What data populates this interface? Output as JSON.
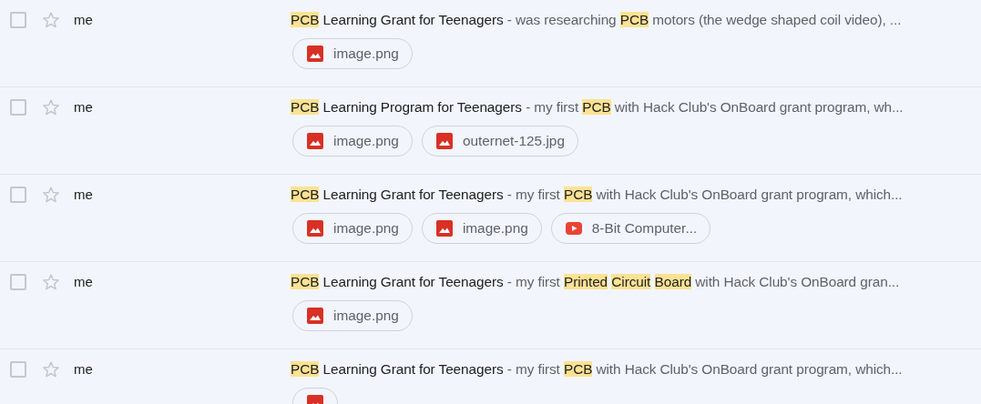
{
  "messages": [
    {
      "checked": false,
      "starred": false,
      "sender": "me",
      "subject": [
        {
          "text": "PCB",
          "highlight": true
        },
        {
          "text": " Learning Grant for Teenagers",
          "highlight": false
        }
      ],
      "snippet": [
        {
          "text": " - was researching ",
          "highlight": false
        },
        {
          "text": "PCB",
          "highlight": true
        },
        {
          "text": " motors (the wedge shaped coil video), ...",
          "highlight": false
        }
      ],
      "attachments": [
        {
          "kind": "image",
          "name": "image.png"
        }
      ]
    },
    {
      "checked": false,
      "starred": false,
      "sender": "me",
      "subject": [
        {
          "text": "PCB",
          "highlight": true
        },
        {
          "text": " Learning Program for Teenagers",
          "highlight": false
        }
      ],
      "snippet": [
        {
          "text": " - my first ",
          "highlight": false
        },
        {
          "text": "PCB",
          "highlight": true
        },
        {
          "text": " with Hack Club's OnBoard grant program, wh...",
          "highlight": false
        }
      ],
      "attachments": [
        {
          "kind": "image",
          "name": "image.png"
        },
        {
          "kind": "image",
          "name": "outernet-125.jpg"
        }
      ]
    },
    {
      "checked": false,
      "starred": false,
      "sender": "me",
      "subject": [
        {
          "text": "PCB",
          "highlight": true
        },
        {
          "text": " Learning Grant for Teenagers",
          "highlight": false
        }
      ],
      "snippet": [
        {
          "text": " - my first ",
          "highlight": false
        },
        {
          "text": "PCB",
          "highlight": true
        },
        {
          "text": " with Hack Club's OnBoard grant program, which...",
          "highlight": false
        }
      ],
      "attachments": [
        {
          "kind": "image",
          "name": "image.png"
        },
        {
          "kind": "image",
          "name": "image.png"
        },
        {
          "kind": "video",
          "name": "8-Bit Computer..."
        }
      ]
    },
    {
      "checked": false,
      "starred": false,
      "sender": "me",
      "subject": [
        {
          "text": "PCB",
          "highlight": true
        },
        {
          "text": " Learning Grant for Teenagers",
          "highlight": false
        }
      ],
      "snippet": [
        {
          "text": " - my first ",
          "highlight": false
        },
        {
          "text": "Printed",
          "highlight": true
        },
        {
          "text": "Circuit",
          "highlight": true
        },
        {
          "text": "Board",
          "highlight": true
        },
        {
          "text": " with Hack Club's OnBoard gran...",
          "highlight": false
        }
      ],
      "attachments": [
        {
          "kind": "image",
          "name": "image.png"
        }
      ]
    },
    {
      "checked": false,
      "starred": false,
      "sender": "me",
      "subject": [
        {
          "text": "PCB",
          "highlight": true
        },
        {
          "text": " Learning Grant for Teenagers",
          "highlight": false
        }
      ],
      "snippet": [
        {
          "text": " - my first ",
          "highlight": false
        },
        {
          "text": "PCB",
          "highlight": true
        },
        {
          "text": " with Hack Club's OnBoard grant program, which...",
          "highlight": false
        }
      ],
      "attachments": [
        {
          "kind": "image"
        }
      ]
    }
  ]
}
